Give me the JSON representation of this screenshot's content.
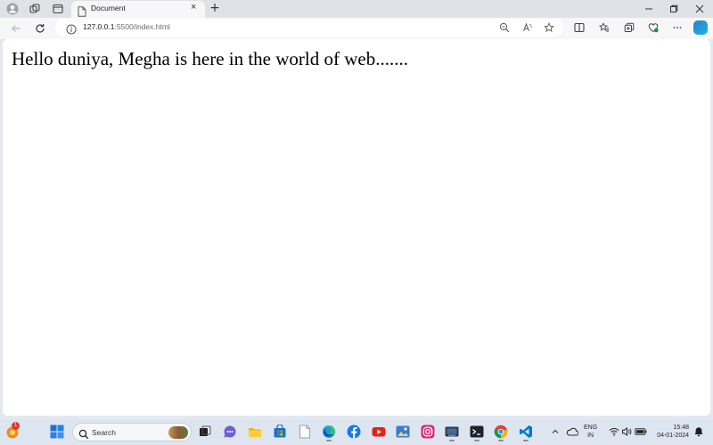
{
  "browser": {
    "tab": {
      "title": "Document",
      "close_glyph": "×"
    },
    "new_tab_glyph": "+",
    "address": {
      "host": "127.0.0.1",
      "path": ":5500/index.html"
    }
  },
  "page": {
    "text": "Hello duniya, Megha is here in the world of web......."
  },
  "taskbar": {
    "notification_count": "1",
    "search_placeholder": "Search",
    "language": {
      "line1": "ENG",
      "line2": "IN"
    },
    "time": "15:48",
    "date": "04-01-2024"
  }
}
